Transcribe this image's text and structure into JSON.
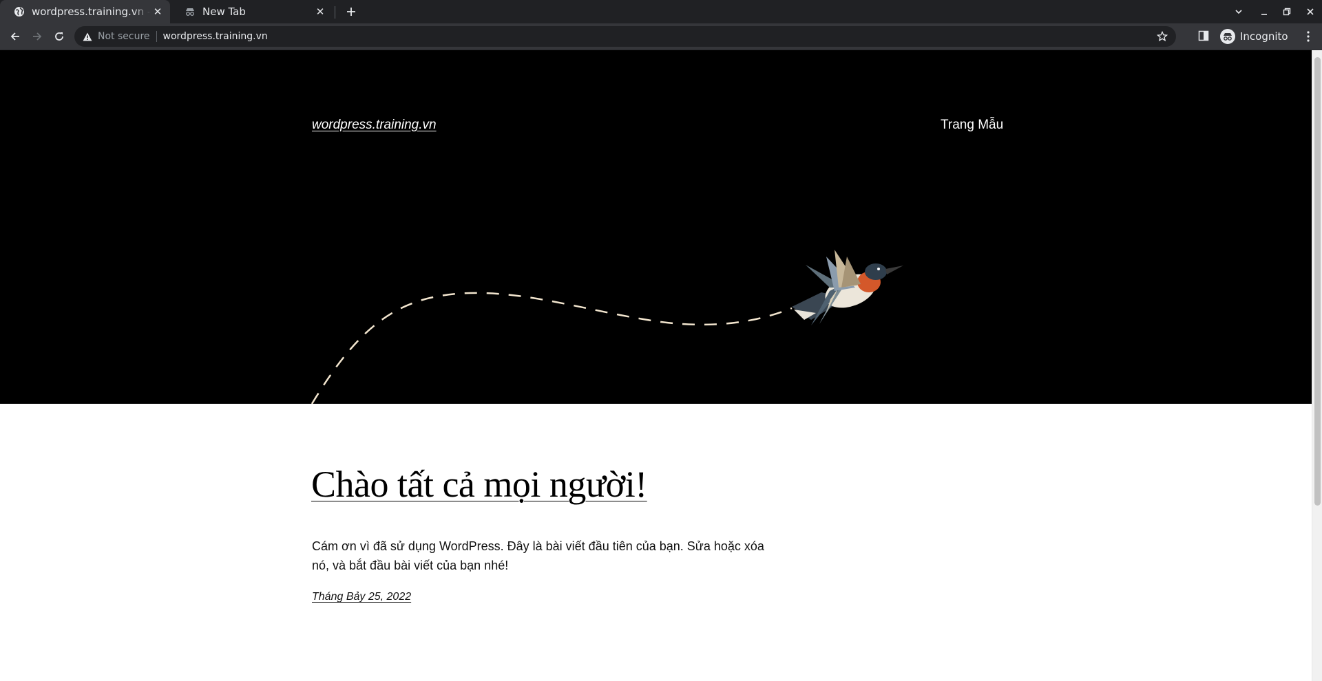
{
  "browser": {
    "tabs": [
      {
        "title": "wordpress.training.vn – N",
        "active": true,
        "icon": "globe-icon"
      },
      {
        "title": "New Tab",
        "active": false,
        "icon": "incognito-icon"
      }
    ],
    "address_bar": {
      "security_label": "Not secure",
      "url": "wordpress.training.vn"
    },
    "profile_label": "Incognito"
  },
  "site": {
    "title": "wordpress.training.vn",
    "nav": [
      {
        "label": "Trang Mẫu"
      }
    ],
    "header_bg": "#000000"
  },
  "post": {
    "title": "Chào tất cả mọi người!",
    "excerpt": "Cám ơn vì đã sử dụng WordPress. Đây là bài viết đầu tiên của bạn. Sửa hoặc xóa nó, và bắt đầu bài viết của bạn nhé!",
    "date": "Tháng Bảy 25, 2022"
  }
}
